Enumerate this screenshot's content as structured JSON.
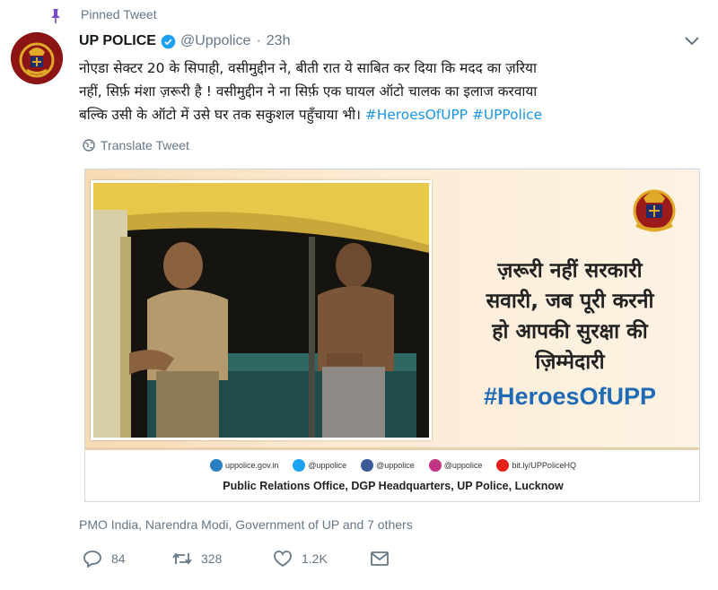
{
  "pinned": {
    "label": "Pinned Tweet"
  },
  "author": {
    "name": "UP POLICE",
    "handle": "@Uppolice",
    "time": "23h"
  },
  "tweet": {
    "line1": "नोएडा सेक्टर 20 के सिपाही, वसीमुद्दीन ने, बीती रात ये साबित कर दिया कि मदद का ज़रिया",
    "line2": "नहीं, सिर्फ़ मंशा ज़रूरी है ! वसीमुद्दीन ने ना सिर्फ़ एक घायल ऑटो चालक का इलाज करवाया",
    "line3_text": "बल्कि उसी के ऑटो में उसे घर तक सकुशल पहुँचाया भी। ",
    "hashtag1": "#HeroesOfUPP",
    "hashtag2": "#UPPolice"
  },
  "translate": {
    "label": "Translate Tweet"
  },
  "poster": {
    "slogan_line1": "ज़रूरी नहीं सरकारी",
    "slogan_line2": "सवारी, जब पूरी करनी",
    "slogan_line3": "हो आपकी सुरक्षा की",
    "slogan_line4": "ज़िम्मेदारी",
    "hashtag": "#HeroesOfUPP",
    "socials": [
      {
        "label": "uppolice.gov.in",
        "color": "#2a7fc1"
      },
      {
        "label": "@uppolice",
        "color": "#1da1f2"
      },
      {
        "label": "@uppolice",
        "color": "#3b5998"
      },
      {
        "label": "@uppolice",
        "color": "#c13584"
      },
      {
        "label": "bit.ly/UPPoliceHQ",
        "color": "#e62117"
      }
    ],
    "office": "Public Relations Office, DGP Headquarters, UP Police, Lucknow"
  },
  "liked_by": "PMO India, Narendra Modi, Government of UP and 7 others",
  "actions": {
    "replies": "84",
    "retweets": "328",
    "likes": "1.2K"
  },
  "colors": {
    "link": "#1b95e0",
    "muted": "#657786",
    "pin": "#794bc4",
    "verified": "#1da1f2"
  }
}
